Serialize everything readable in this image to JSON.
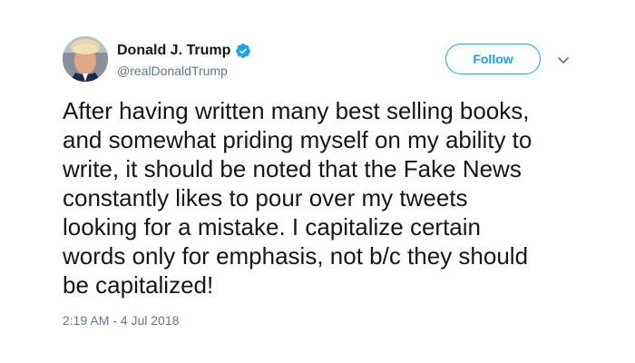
{
  "author": {
    "display_name": "Donald J. Trump",
    "handle": "@realDonaldTrump",
    "verified": true
  },
  "actions": {
    "follow_label": "Follow",
    "menu_icon": "chevron-down-icon"
  },
  "tweet": {
    "text": "After having written many best selling books,\nand somewhat priding myself on my ability to\nwrite, it should be noted that the Fake News\nconstantly likes to pour over my tweets\nlooking for a mistake. I capitalize certain\nwords only for emphasis, not b/c they should\nbe capitalized!",
    "timestamp": "2:19 AM - 4 Jul 2018"
  },
  "colors": {
    "accent": "#1da1f2",
    "text_primary": "#14171a",
    "text_secondary": "#657786"
  }
}
